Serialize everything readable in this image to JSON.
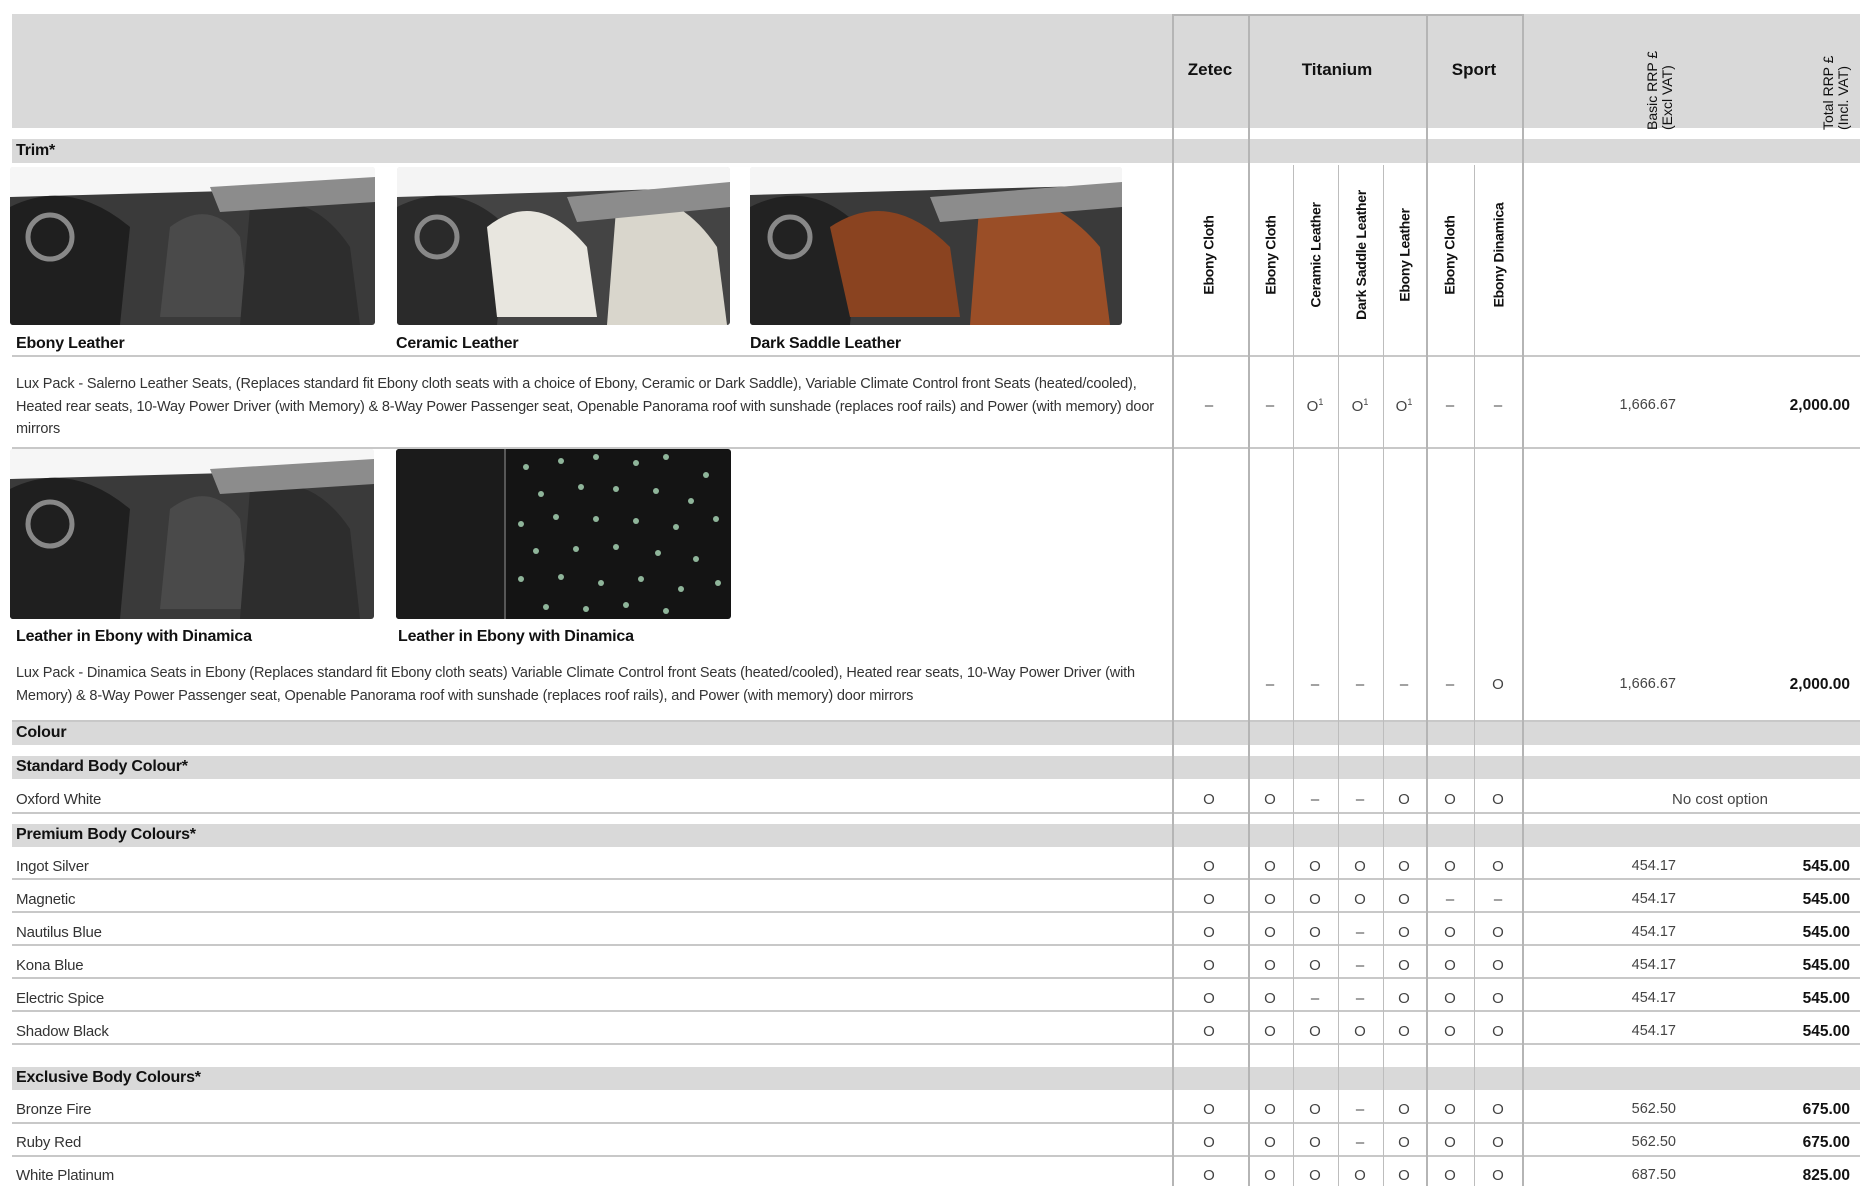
{
  "header": {
    "groups": [
      "Zetec",
      "Titanium",
      "Sport"
    ],
    "basic_rrp": [
      "Basic RRP £",
      "(Excl VAT)"
    ],
    "total_rrp": [
      "Total RRP £",
      "(Incl. VAT)"
    ]
  },
  "trim": {
    "label": "Trim*",
    "columns": [
      "Ebony Cloth",
      "Ebony Cloth",
      "Ceramic Leather",
      "Dark Saddle Leather",
      "Ebony Leather",
      "Ebony Cloth",
      "Ebony Dinamica"
    ],
    "photos1": [
      "Ebony Leather",
      "Ceramic Leather",
      "Dark Saddle Leather"
    ],
    "photos2": [
      "Leather in Ebony with Dinamica",
      "Leather in Ebony with Dinamica"
    ],
    "lux1": {
      "desc": "Lux Pack - Salerno Leather Seats, (Replaces standard fit Ebony cloth seats with a choice of Ebony, Ceramic or Dark Saddle), Variable Climate Control front Seats (heated/cooled), Heated rear seats, 10-Way Power Driver (with Memory) & 8-Way Power Passenger seat, Openable Panorama roof with sunshade (replaces roof rails) and Power (with memory) door mirrors",
      "cells": [
        "–",
        "–",
        "O",
        "O",
        "O",
        "–",
        "–"
      ],
      "sup": [
        "",
        "",
        "1",
        "1",
        "1",
        "",
        ""
      ],
      "basic": "1,666.67",
      "total": "2,000.00"
    },
    "lux2": {
      "desc": "Lux Pack - Dinamica Seats in Ebony (Replaces standard fit Ebony cloth seats) Variable Climate Control front Seats (heated/cooled), Heated rear seats, 10-Way Power Driver (with Memory) & 8-Way Power Passenger seat, Openable Panorama roof with sunshade (replaces roof rails), and Power (with memory) door mirrors",
      "cells": [
        "",
        "–",
        "–",
        "–",
        "–",
        "–",
        "O"
      ],
      "basic": "1,666.67",
      "total": "2,000.00"
    }
  },
  "colour": {
    "label": "Colour",
    "standard": {
      "label": "Standard Body Colour*",
      "rows": [
        {
          "name": "Oxford White",
          "cells": [
            "O",
            "O",
            "–",
            "–",
            "O",
            "O",
            "O"
          ],
          "note": "No cost option"
        }
      ]
    },
    "premium": {
      "label": "Premium Body Colours*",
      "rows": [
        {
          "name": "Ingot Silver",
          "cells": [
            "O",
            "O",
            "O",
            "O",
            "O",
            "O",
            "O"
          ],
          "basic": "454.17",
          "total": "545.00"
        },
        {
          "name": "Magnetic",
          "cells": [
            "O",
            "O",
            "O",
            "O",
            "O",
            "–",
            "–"
          ],
          "basic": "454.17",
          "total": "545.00"
        },
        {
          "name": "Nautilus Blue",
          "cells": [
            "O",
            "O",
            "O",
            "–",
            "O",
            "O",
            "O"
          ],
          "basic": "454.17",
          "total": "545.00"
        },
        {
          "name": "Kona Blue",
          "cells": [
            "O",
            "O",
            "O",
            "–",
            "O",
            "O",
            "O"
          ],
          "basic": "454.17",
          "total": "545.00"
        },
        {
          "name": "Electric Spice",
          "cells": [
            "O",
            "O",
            "–",
            "–",
            "O",
            "O",
            "O"
          ],
          "basic": "454.17",
          "total": "545.00"
        },
        {
          "name": "Shadow Black",
          "cells": [
            "O",
            "O",
            "O",
            "O",
            "O",
            "O",
            "O"
          ],
          "basic": "454.17",
          "total": "545.00"
        }
      ]
    },
    "exclusive": {
      "label": "Exclusive Body Colours*",
      "rows": [
        {
          "name": "Bronze Fire",
          "cells": [
            "O",
            "O",
            "O",
            "–",
            "O",
            "O",
            "O"
          ],
          "basic": "562.50",
          "total": "675.00"
        },
        {
          "name": "Ruby Red",
          "cells": [
            "O",
            "O",
            "O",
            "–",
            "O",
            "O",
            "O"
          ],
          "basic": "562.50",
          "total": "675.00"
        },
        {
          "name": "White Platinum",
          "cells": [
            "O",
            "O",
            "O",
            "O",
            "O",
            "O",
            "O"
          ],
          "basic": "687.50",
          "total": "825.00"
        }
      ]
    }
  }
}
